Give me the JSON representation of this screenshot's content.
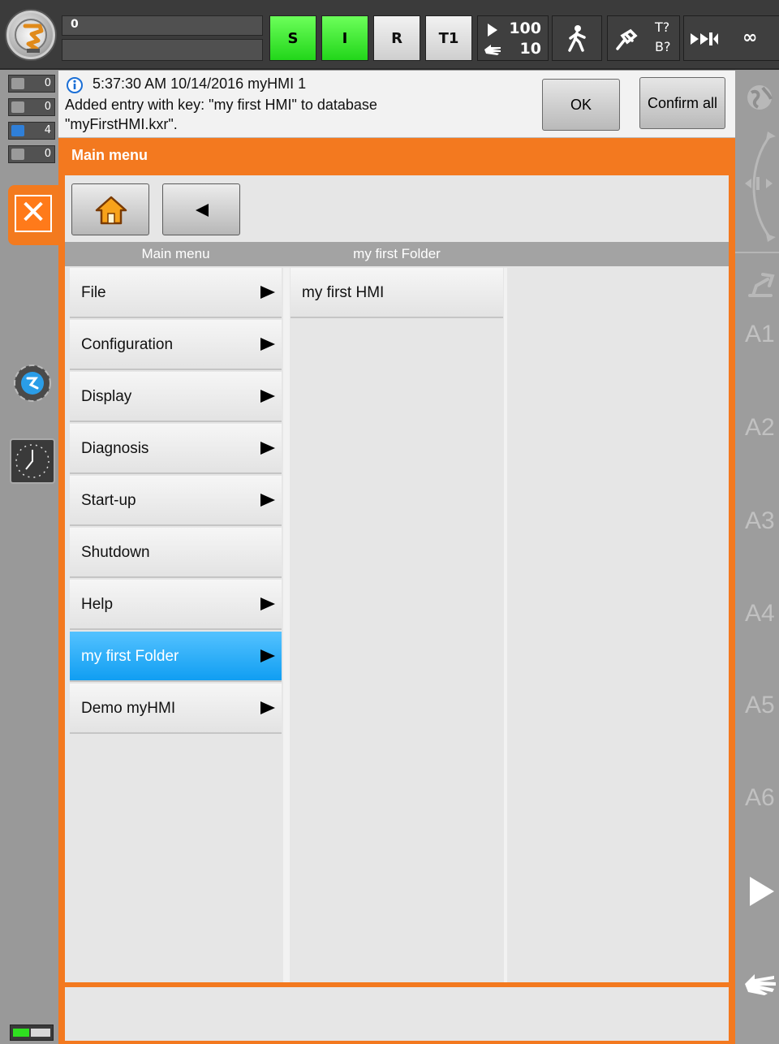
{
  "topbar": {
    "program_field": "0",
    "submit_label": "S",
    "drives_label": "I",
    "run_mode_label": "R",
    "op_mode_label": "T1",
    "override_prog": "100",
    "override_jog": "10",
    "tool_label": "T?",
    "base_label": "B?",
    "infinite_label": "∞"
  },
  "left_counters": [
    {
      "type": "ack",
      "count": "0",
      "color": "#9a9a9a"
    },
    {
      "type": "state",
      "count": "0",
      "color": "#9a9a9a"
    },
    {
      "type": "info",
      "count": "4",
      "color": "#2f7fd8"
    },
    {
      "type": "wait",
      "count": "0",
      "color": "#9a9a9a"
    }
  ],
  "message": {
    "header": "5:37:30 AM 10/14/2016 myHMI 1",
    "line1": "Added entry with key: \"my first HMI\" to database",
    "line2": "\"myFirstHMI.kxr\".",
    "ok_label": "OK",
    "confirm_all_label": "Confirm all"
  },
  "panel": {
    "title": "Main menu",
    "col1_header": "Main menu",
    "col2_header": "my first Folder"
  },
  "menu_items": [
    {
      "label": "File",
      "submenu": true
    },
    {
      "label": "Configuration",
      "submenu": true
    },
    {
      "label": "Display",
      "submenu": true
    },
    {
      "label": "Diagnosis",
      "submenu": true
    },
    {
      "label": "Start-up",
      "submenu": true
    },
    {
      "label": "Shutdown",
      "submenu": false
    },
    {
      "label": "Help",
      "submenu": true
    },
    {
      "label": "my first Folder",
      "submenu": true,
      "selected": true
    },
    {
      "label": "Demo myHMI",
      "submenu": true
    }
  ],
  "submenu_items": [
    {
      "label": "my first HMI"
    }
  ],
  "right_axes": [
    "A1",
    "A2",
    "A3",
    "A4",
    "A5",
    "A6"
  ],
  "colors": {
    "accent_orange": "#f3791f",
    "selected_blue": "#1aa5f5",
    "status_green": "#2fe020"
  }
}
